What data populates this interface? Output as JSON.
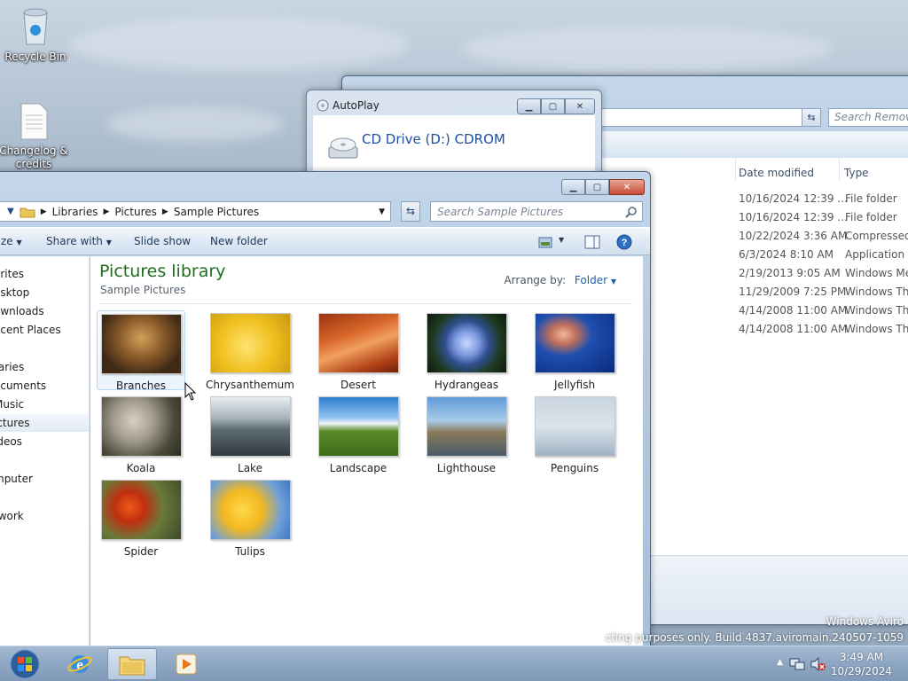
{
  "desktop": {
    "icons": [
      {
        "label": "Recycle Bin",
        "icon": "recycle-bin-icon"
      },
      {
        "label": "Changelog & credits",
        "icon": "text-file-icon"
      }
    ],
    "watermark_line1": "Windows Aviro",
    "watermark_line2": "cting purposes only. Build 4837.aviromain.240507-1059"
  },
  "back_window": {
    "address_tail": ":)",
    "search_placeholder": "Search Remova",
    "columns": [
      "Date modified",
      "Type"
    ],
    "rows": [
      {
        "date": "10/16/2024 12:39 ...",
        "type": "File folder"
      },
      {
        "date": "10/16/2024 12:39 ...",
        "type": "File folder"
      },
      {
        "date": "10/22/2024 3:36 AM",
        "type": "Compressed ("
      },
      {
        "date": "6/3/2024 8:10 AM",
        "type": "Application"
      },
      {
        "date": "2/19/2013 9:05 AM",
        "type": "Windows Med"
      },
      {
        "date": "11/29/2009 7:25 PM",
        "type": "Windows The"
      },
      {
        "date": "4/14/2008 11:00 AM",
        "type": "Windows The"
      },
      {
        "date": "4/14/2008 11:00 AM",
        "type": "Windows The"
      }
    ]
  },
  "autoplay": {
    "title": "AutoPlay",
    "drive_label": "CD Drive (D:) CDROM"
  },
  "explorer": {
    "breadcrumb": [
      "Libraries",
      "Pictures",
      "Sample Pictures"
    ],
    "search_placeholder": "Search Sample Pictures",
    "toolbar": {
      "organize_partial": "ze",
      "share_with": "Share with",
      "slide_show": "Slide show",
      "new_folder": "New folder"
    },
    "nav": [
      {
        "label": "orites",
        "top": 0
      },
      {
        "label": "esktop"
      },
      {
        "label": "ownloads"
      },
      {
        "label": "ecent Places"
      },
      {
        "label": "raries"
      },
      {
        "label": "ocuments"
      },
      {
        "label": "Music"
      },
      {
        "label": "ictures"
      },
      {
        "label": "ideos"
      },
      {
        "label": "mputer"
      },
      {
        "label": "twork"
      }
    ],
    "library_title": "Pictures library",
    "library_subtitle": "Sample Pictures",
    "arrange_label": "Arrange by:",
    "arrange_value": "Folder",
    "thumbnails": [
      "Branches",
      "Chrysanthemum",
      "Desert",
      "Hydrangeas",
      "Jellyfish",
      "Koala",
      "Lake",
      "Landscape",
      "Lighthouse",
      "Penguins",
      "Spider",
      "Tulips"
    ]
  },
  "taskbar": {
    "time": "3:49 AM",
    "date": "10/29/2024"
  }
}
